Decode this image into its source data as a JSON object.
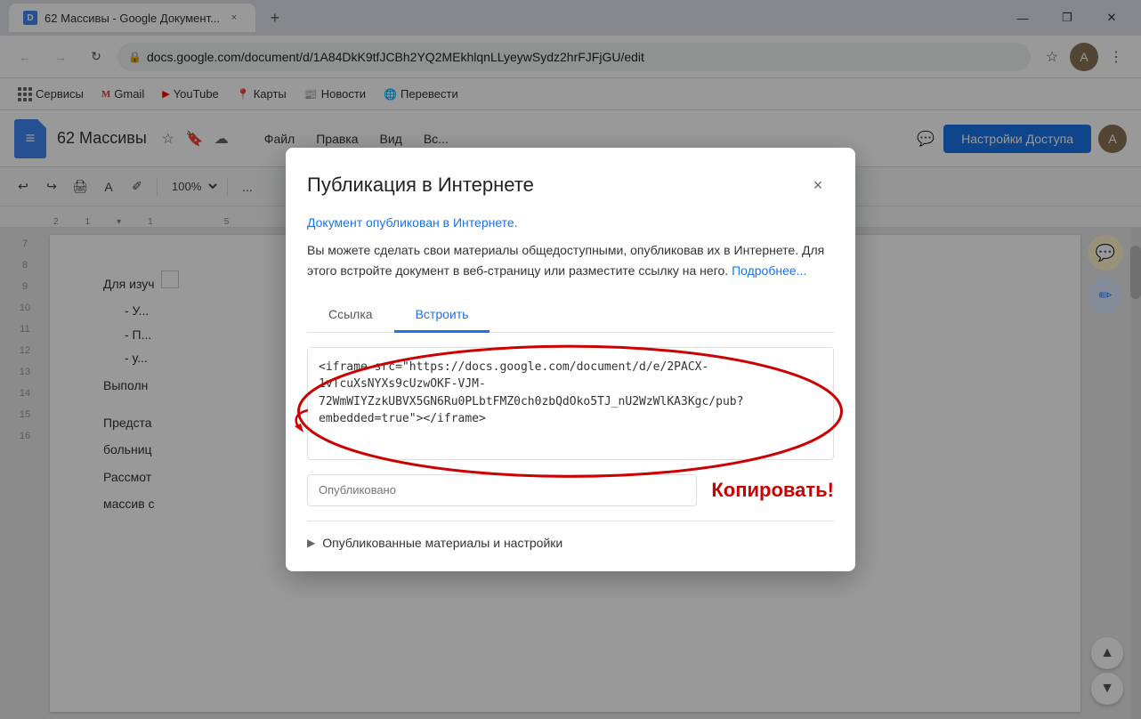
{
  "browser": {
    "tab_title": "62 Массивы - Google Документ...",
    "tab_close": "×",
    "new_tab": "+",
    "win_minimize": "—",
    "win_restore": "❐",
    "win_close": "✕",
    "back_btn": "←",
    "forward_btn": "→",
    "refresh_btn": "↻",
    "url": "docs.google.com/document/d/1A84DkK9tfJCBh2YQ2MEkhlqnLLyeywSydz2hrFJFjGU/edit",
    "bookmark_star": "☆",
    "profile_initial": "A",
    "more_icon": "⋮"
  },
  "bookmarks": {
    "apps_label": "Сервисы",
    "gmail_label": "Gmail",
    "youtube_label": "YouTube",
    "maps_label": "Карты",
    "news_label": "Новости",
    "translate_label": "Перевести"
  },
  "docs": {
    "title": "62 Массивы",
    "star_icon": "☆",
    "nav": {
      "file": "Файл",
      "edit": "Правка",
      "view": "Вид",
      "insert": "Вс..."
    },
    "toolbar": {
      "undo": "↩",
      "redo": "↪",
      "print": "🖨",
      "spell": "A",
      "paint": "✐",
      "zoom": "100%",
      "more": "..."
    },
    "share_btn": "Настройки Доступа"
  },
  "document": {
    "section1": "Для изуч",
    "bullet1": "У...",
    "bullet2": "П...",
    "bullet3": "у...",
    "section2": "Выполн",
    "section3": "Предста",
    "section4": "больниц",
    "section5": "Рассмот",
    "section6": "массив с"
  },
  "modal": {
    "title": "Публикация в Интернете",
    "close": "×",
    "published_link": "Документ опубликован в Интернете.",
    "description": "Вы можете сделать свои материалы общедоступными, опубликовав их в Интернете. Для этого встройте документ в веб-страницу или разместите ссылку на него.",
    "more_link": "Подробнее...",
    "tab_link": "Ссылка",
    "tab_embed": "Встроить",
    "embed_code": "<iframe src=\"https://docs.google.com/document/d/e/2PACX-1vTcuXsNYXs9cUzwOKF-VJM-72WmWIYZzkUBVX5GN6Ru0PLbtFMZ0ch0zbQdOko5TJ_nU2WzWlKA3Kgc/pub?embedded=true\"></iframe>",
    "copy_placeholder": "Опубликовано",
    "copy_label": "Копировать!",
    "published_section": "Опубликованные материалы и настройки"
  },
  "right_panel": {
    "comment_icon": "💬",
    "edit_icon": "✏️",
    "nav_up": "▲",
    "nav_down": "▼"
  },
  "line_numbers": [
    "7",
    "8",
    "9",
    "10",
    "11",
    "12",
    "13",
    "14",
    "15",
    "16"
  ]
}
